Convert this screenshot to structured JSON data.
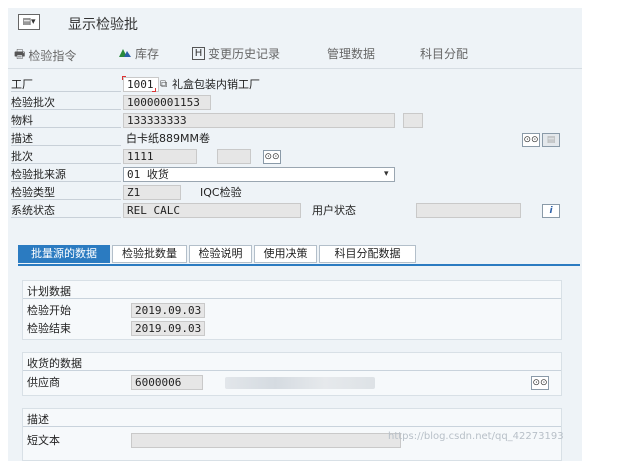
{
  "window": {
    "title": "显示检验批"
  },
  "toolbar": {
    "items": [
      {
        "label": "检验指令",
        "icon": "printer-icon"
      },
      {
        "label": "库存",
        "icon": "stock-icon"
      },
      {
        "label": "变更历史记录",
        "icon": "history-icon",
        "icon_glyph": "H"
      },
      {
        "label": "管理数据"
      },
      {
        "label": "科目分配"
      }
    ]
  },
  "header": {
    "plant": {
      "label": "工厂",
      "value": "1001",
      "desc": "礼盒包装内销工厂"
    },
    "inspection_lot": {
      "label": "检验批次",
      "value": "10000001153"
    },
    "material": {
      "label": "物料",
      "value": "133333333"
    },
    "description": {
      "label": "描述",
      "value": "白卡纸889MM卷"
    },
    "batch": {
      "label": "批次",
      "value": "1111"
    },
    "lot_origin": {
      "label": "检验批来源",
      "value": "01 收货"
    },
    "inspection_type": {
      "label": "检验类型",
      "value": "Z1",
      "desc": "IQC检验"
    },
    "system_status": {
      "label": "系统状态",
      "value": "REL  CALC"
    },
    "user_status": {
      "label": "用户状态",
      "value": ""
    }
  },
  "tabs": [
    {
      "label": "批量源的数据",
      "active": true
    },
    {
      "label": "检验批数量",
      "active": false
    },
    {
      "label": "检验说明",
      "active": false
    },
    {
      "label": "使用决策",
      "active": false
    },
    {
      "label": "科目分配数据",
      "active": false
    }
  ],
  "planned_data": {
    "title": "计划数据",
    "start": {
      "label": "检验开始",
      "value": "2019.09.03"
    },
    "end": {
      "label": "检验结束",
      "value": "2019.09.03"
    }
  },
  "goods_receipt": {
    "title": "收货的数据",
    "vendor": {
      "label": "供应商",
      "value": "6000006"
    }
  },
  "description_group": {
    "title": "描述",
    "short_text": {
      "label": "短文本",
      "value": ""
    }
  },
  "watermark": "https://blog.csdn.net/qq_42273193",
  "colors": {
    "accent": "#2b7bc1",
    "background": "#eef3f7"
  }
}
